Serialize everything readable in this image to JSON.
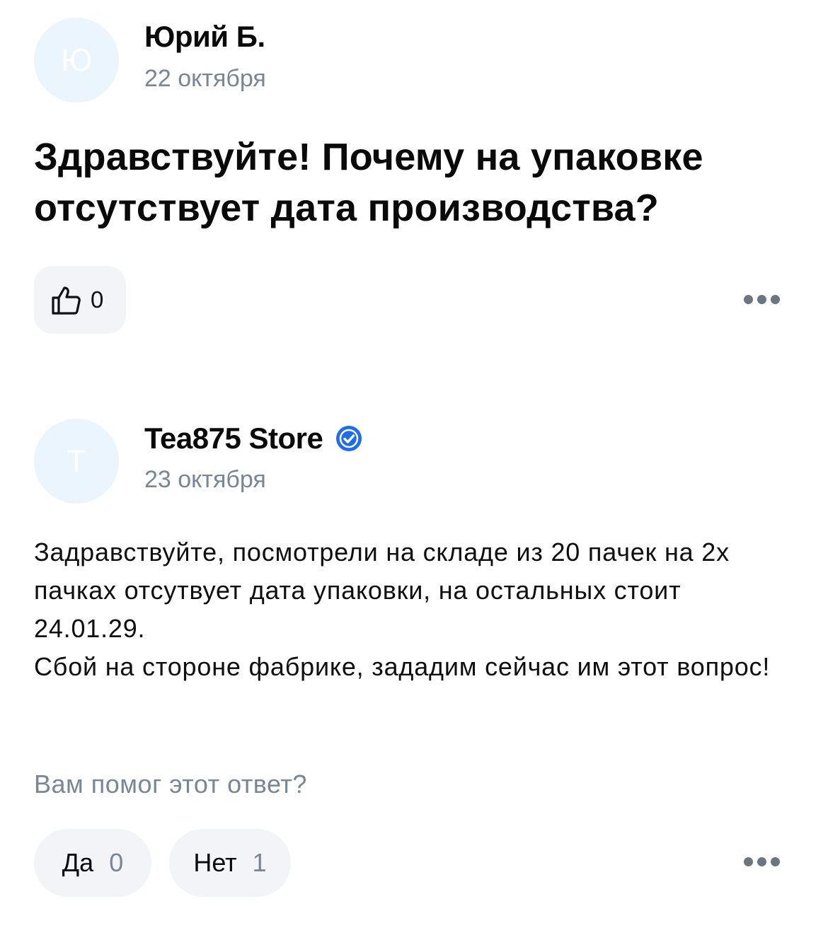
{
  "question": {
    "avatar_letter": "Ю",
    "author": "Юрий Б.",
    "date": "22 октября",
    "text": "Здравствуйте! Почему на упаковке отсутствует дата производства?",
    "likes": "0"
  },
  "answer": {
    "avatar_letter": "T",
    "author": "Tea875 Store",
    "date": "23 октября",
    "text": "Задравствуйте, посмотрели на складе из 20 пачек на 2х пачках отсутвует дата упаковки, на остальных стоит 24.01.29.\nСбой на стороне фабрике, зададим сейчас им этот вопрос!"
  },
  "feedback": {
    "question": "Вам помог этот ответ?",
    "yes_label": "Да",
    "yes_count": "0",
    "no_label": "Нет",
    "no_count": "1"
  },
  "colors": {
    "avatar_bg": "#eaf5fd",
    "muted_text": "#7a8694",
    "button_bg": "#f3f4f8",
    "verified_blue": "#1f6cf0"
  }
}
